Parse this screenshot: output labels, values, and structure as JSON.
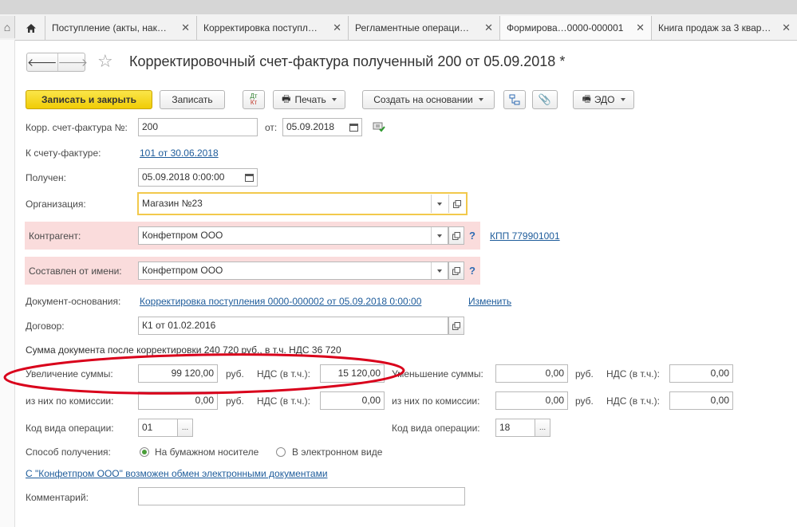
{
  "tabs": [
    {
      "label": "Поступление (акты, нак…"
    },
    {
      "label": "Корректировка поступл…"
    },
    {
      "label": "Регламентные операци…"
    },
    {
      "label": "Формирова…0000-000001"
    },
    {
      "label": "Книга продаж за 3 квар…"
    }
  ],
  "title": "Корректировочный счет-фактура полученный 200 от 05.09.2018 *",
  "toolbar": {
    "save_close": "Записать и закрыть",
    "save": "Записать",
    "print": "Печать",
    "create_based": "Создать на основании",
    "edo": "ЭДО"
  },
  "form": {
    "invoice_label": "Корр. счет-фактура №:",
    "invoice_number": "200",
    "from_label": "от:",
    "invoice_date": "05.09.2018",
    "to_invoice_label": "К счету-фактуре:",
    "to_invoice_link": "101 от 30.06.2018",
    "received_label": "Получен:",
    "received_value": "05.09.2018  0:00:00",
    "org_label": "Организация:",
    "org_value": "Магазин №23",
    "contractor_label": "Контрагент:",
    "contractor_value": "Конфетпром ООО",
    "kpp_link": "КПП 779901001",
    "issued_label": "Составлен от имени:",
    "issued_value": "Конфетпром ООО",
    "basis_label": "Документ-основания:",
    "basis_link": "Корректировка поступления 0000-000002 от 05.09.2018 0:00:00",
    "change_link": "Изменить",
    "contract_label": "Договор:",
    "contract_value": "К1 от 01.02.2016",
    "summary": "Сумма документа после корректировки 240 720 руб., в т.ч. НДС 36 720",
    "increase_label": "Увеличение суммы:",
    "increase_value": "99 120,00",
    "rub": "руб.",
    "vat_label": "НДС (в т.ч.):",
    "increase_vat": "15 120,00",
    "decrease_label": "Уменьшение суммы:",
    "decrease_value": "0,00",
    "decrease_vat": "0,00",
    "commission_label": "из них по комиссии:",
    "commission_inc": "0,00",
    "commission_inc_vat": "0,00",
    "commission_dec": "0,00",
    "commission_dec_vat": "0,00",
    "opcode_label": "Код вида операции:",
    "opcode_left": "01",
    "opcode_right": "18",
    "method_label": "Способ получения:",
    "method_paper": "На бумажном носителе",
    "method_electronic": "В электронном виде",
    "edo_link": "С \"Конфетпром ООО\" возможен обмен электронными документами",
    "comment_label": "Комментарий:",
    "ellipsis": "..."
  },
  "colors": {
    "accent_yellow": "#f5d411",
    "required_pink": "#fadcdc",
    "link_blue": "#1e5c9b",
    "annotation_red": "#d9001b"
  },
  "icons": [
    "home-icon",
    "close-icon",
    "back-arrow-icon",
    "forward-arrow-icon",
    "star-icon",
    "dt-kt-icon",
    "printer-icon",
    "structure-icon",
    "paperclip-icon",
    "calendar-icon",
    "open-icon",
    "help-icon"
  ]
}
